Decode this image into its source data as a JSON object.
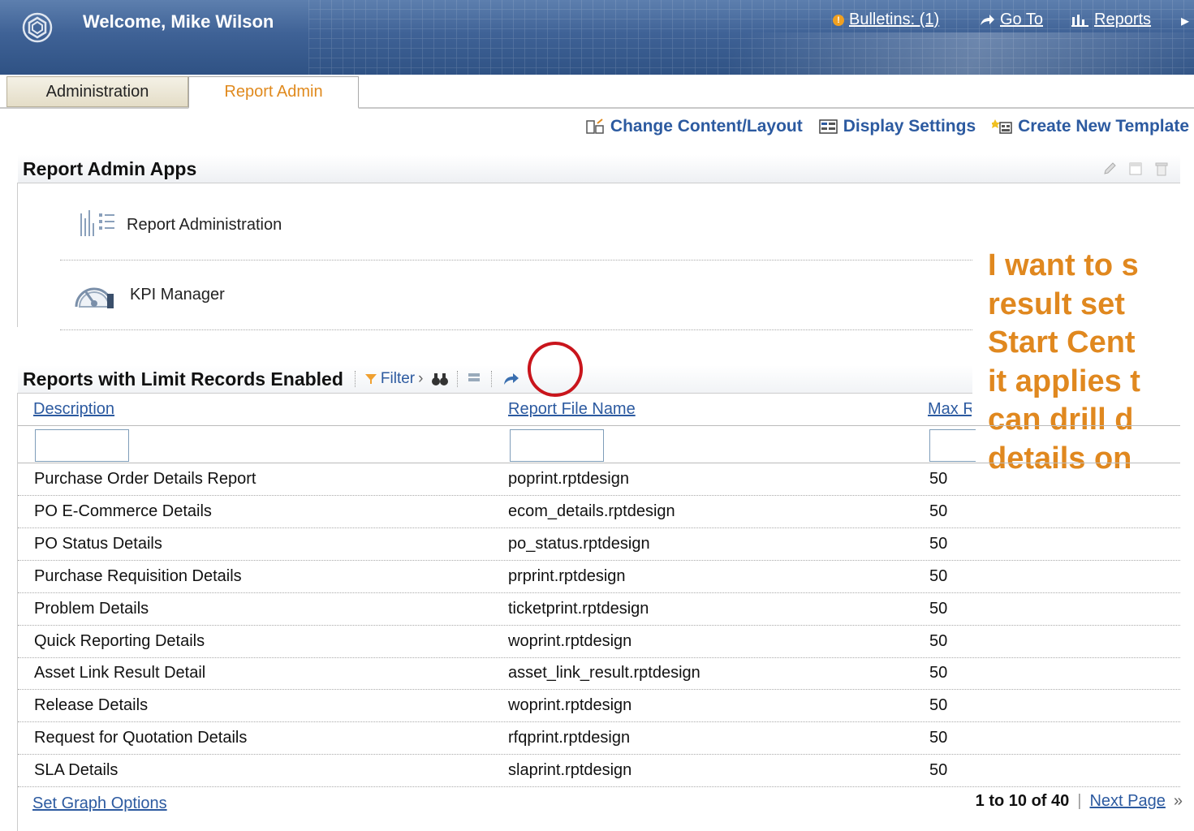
{
  "header": {
    "welcome": "Welcome, Mike Wilson",
    "bulletins": "Bulletins: (1)",
    "goto": "Go To",
    "reports": "Reports"
  },
  "tabs": [
    "Administration",
    "Report Admin"
  ],
  "actions": {
    "change_content": "Change Content/Layout",
    "display_settings": "Display Settings",
    "create_template": "Create New Template"
  },
  "report_admin_apps": {
    "title": "Report Admin Apps",
    "apps": [
      "Report Administration",
      "KPI Manager"
    ]
  },
  "annotation": {
    "lines": [
      "I want to s",
      "result set",
      "Start Cent",
      "it applies t",
      "can drill d",
      "details on"
    ],
    "color": "#e0881f"
  },
  "reports_table": {
    "title": "Reports with Limit Records Enabled",
    "filter_label": "Filter",
    "columns": [
      "Description",
      "Report File Name",
      "Max Rec"
    ],
    "rows": [
      {
        "description": "Purchase Order Details Report",
        "file": "poprint.rptdesign",
        "max": "50"
      },
      {
        "description": "PO E-Commerce Details",
        "file": "ecom_details.rptdesign",
        "max": "50"
      },
      {
        "description": "PO Status Details",
        "file": "po_status.rptdesign",
        "max": "50"
      },
      {
        "description": "Purchase Requisition Details",
        "file": "prprint.rptdesign",
        "max": "50"
      },
      {
        "description": "Problem Details",
        "file": "ticketprint.rptdesign",
        "max": "50"
      },
      {
        "description": "Quick Reporting Details",
        "file": "woprint.rptdesign",
        "max": "50"
      },
      {
        "description": "Asset Link Result Detail",
        "file": "asset_link_result.rptdesign",
        "max": "50"
      },
      {
        "description": "Release Details",
        "file": "woprint.rptdesign",
        "max": "50"
      },
      {
        "description": "Request for Quotation Details",
        "file": "rfqprint.rptdesign",
        "max": "50"
      },
      {
        "description": "SLA Details",
        "file": "slaprint.rptdesign",
        "max": "50"
      }
    ],
    "set_graph_options": "Set Graph Options",
    "pager_range": "1 to 10 of 40",
    "next_page": "Next Page"
  }
}
